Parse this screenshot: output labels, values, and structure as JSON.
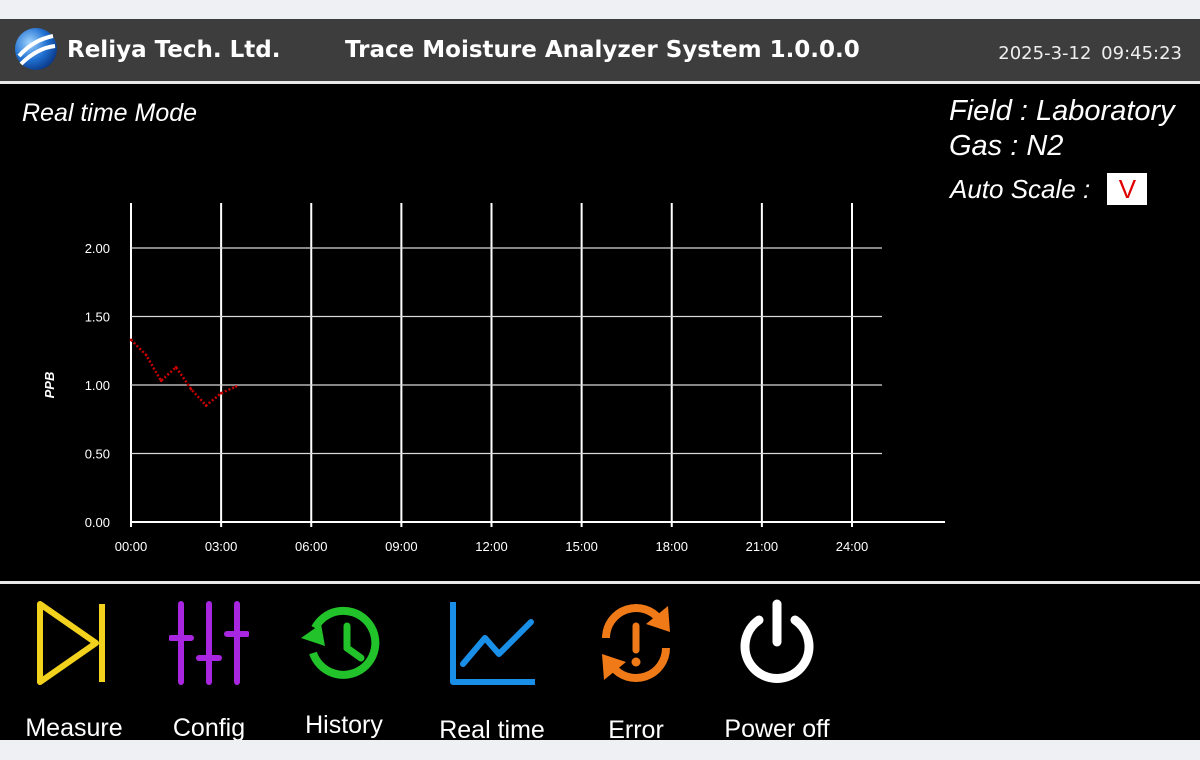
{
  "header": {
    "company": "Reliya Tech. Ltd.",
    "app_title": "Trace Moisture Analyzer System 1.0.0.0",
    "datetime": "2025-3-12  09:45:23"
  },
  "panel": {
    "mode": "Real time Mode",
    "field": "Field : Laboratory",
    "gas": "Gas : N2",
    "auto_scale_label": "Auto Scale :",
    "auto_scale_value": "V"
  },
  "chart_data": {
    "type": "line",
    "ylabel": "PPB",
    "xlabel": "",
    "title": "",
    "x_ticks": [
      "00:00",
      "03:00",
      "06:00",
      "09:00",
      "12:00",
      "15:00",
      "18:00",
      "21:00",
      "24:00"
    ],
    "y_ticks": [
      "0.00",
      "0.50",
      "1.00",
      "1.50",
      "2.00"
    ],
    "xlim": [
      "00:00",
      "24:00"
    ],
    "ylim": [
      0,
      2.2
    ],
    "grid": true,
    "series": [
      {
        "color": "#cc0000",
        "x": [
          "00:00",
          "00:30",
          "01:00",
          "01:30",
          "02:00",
          "02:30",
          "03:00",
          "03:30"
        ],
        "y": [
          1.33,
          1.22,
          1.03,
          1.13,
          0.97,
          0.85,
          0.94,
          0.99
        ]
      }
    ]
  },
  "colors": {
    "measure": "#f2d21c",
    "config": "#a826e0",
    "history": "#22c22a",
    "realtime": "#1a8fe8",
    "error": "#f07a18",
    "poweroff": "#ffffff",
    "header_bg": "#3d3d3d"
  },
  "toolbar": {
    "items": [
      {
        "label": "Measure",
        "icon": "measure-icon"
      },
      {
        "label": "Config",
        "icon": "sliders-icon"
      },
      {
        "label": "History",
        "icon": "history-icon"
      },
      {
        "label": "Real time",
        "icon": "line-chart-icon"
      },
      {
        "label": "Error",
        "icon": "error-icon"
      },
      {
        "label": "Power off",
        "icon": "power-icon"
      }
    ]
  }
}
